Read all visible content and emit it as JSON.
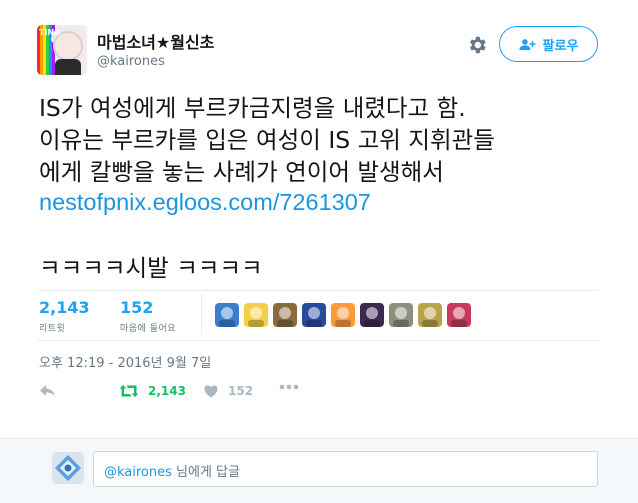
{
  "user": {
    "display_name": "마법소녀★월신초",
    "handle": "@kairones",
    "avatar_tag": "TINA"
  },
  "header": {
    "follow_label": "팔로우",
    "settings_icon": "gear-icon",
    "follow_icon": "add-user-icon"
  },
  "tweet": {
    "text": "IS가 여성에게 부르카금지령을 내렸다고 함.\n이유는 부르카를 입은 여성이 IS 고위 지휘관들\n에게 칼빵을 놓는 사례가 연이어 발생해서",
    "link": "nestofpnix.egloos.com/7261307",
    "text2": "ㅋㅋㅋㅋ시발 ㅋㅋㅋㅋ"
  },
  "stats": {
    "retweets_count": "2,143",
    "retweets_label": "리트윗",
    "likes_count": "152",
    "likes_label": "마음에 들어요"
  },
  "likers": [
    {
      "name": "liker-1",
      "color": "#3a7ecf"
    },
    {
      "name": "liker-2",
      "color": "#f2d04a"
    },
    {
      "name": "liker-3",
      "color": "#8a6a3e"
    },
    {
      "name": "liker-4",
      "color": "#2a4aa0"
    },
    {
      "name": "liker-5",
      "color": "#ff9a3c"
    },
    {
      "name": "liker-6",
      "color": "#3c2a4e"
    },
    {
      "name": "liker-7",
      "color": "#8e8e80"
    },
    {
      "name": "liker-8",
      "color": "#b9a24a"
    },
    {
      "name": "liker-9",
      "color": "#c83a5a"
    }
  ],
  "timestamp": "오후 12:19 - 2016년 9월 7일",
  "actions": {
    "reply_icon": "reply-icon",
    "retweet_icon": "retweet-icon",
    "retweet_count": "2,143",
    "like_icon": "heart-icon",
    "like_count": "152",
    "more_icon": "more-icon"
  },
  "reply": {
    "mention": "@kairones",
    "placeholder_suffix": " 님에게 답글"
  },
  "colors": {
    "accent": "#1da1f2",
    "retweet_green": "#17bf63",
    "muted": "#aab8c2"
  }
}
